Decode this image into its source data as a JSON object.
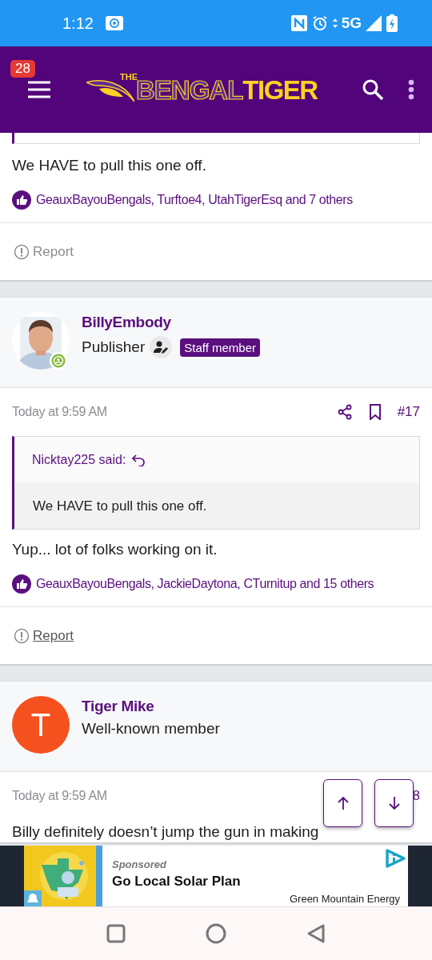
{
  "status_bar": {
    "time": "1:12",
    "network": "5G"
  },
  "header": {
    "notification_count": "28",
    "logo": {
      "prefix": "THE",
      "word_1": "BENGAL",
      "word_2": "TIGER"
    }
  },
  "posts": [
    {
      "kind": "partial",
      "body": "We HAVE to pull this one off.",
      "reactions": "GeauxBayouBengals, Turftoe4, UtahTigerEsq and 7 others",
      "report": {
        "label": "Report",
        "focused": false
      }
    },
    {
      "kind": "full",
      "author": {
        "name": "BillyEmbody",
        "title": "Publisher",
        "badge": "Staff member",
        "online": true
      },
      "time": "Today at 9:59 AM",
      "actions": [
        {
          "kind": "share"
        },
        {
          "kind": "bookmark"
        }
      ],
      "number": "#17",
      "quote": {
        "author": "Nicktay225 said:",
        "text": "We HAVE to pull this one off."
      },
      "body": "Yup... lot of folks working on it.",
      "reactions": "GeauxBayouBengals, JackieDaytona, CTurnitup and 15 others",
      "report": {
        "label": "Report",
        "focused": true
      }
    },
    {
      "kind": "full",
      "author": {
        "name": "Tiger Mike",
        "title": "Well-known member",
        "avatar": {
          "kind": "letter",
          "initial": "T",
          "color": "#f4511e"
        }
      },
      "time": "Today at 9:59 AM",
      "number": "8",
      "body": "Billy definitely doesn’t jump the gun in making"
    }
  ],
  "ad": {
    "label": "Sponsored",
    "title": "Go Local Solar Plan",
    "advertiser": "Green Mountain Energy"
  }
}
